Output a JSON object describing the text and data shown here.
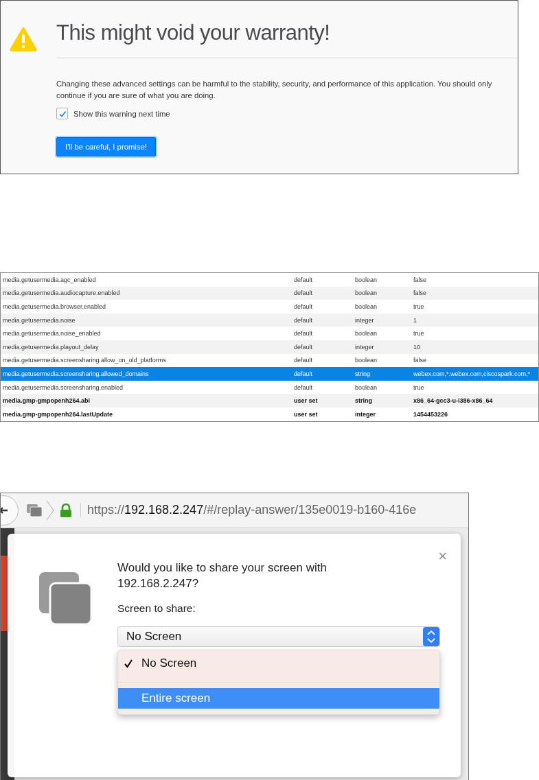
{
  "warning": {
    "title": "This might void your warranty!",
    "message": "Changing these advanced settings can be harmful to the stability, security, and performance of this application. You should only continue if you are sure of what you are doing.",
    "checkbox": {
      "label": "Show this warning next time",
      "checked": true
    },
    "button": "I'll be careful, I promise!"
  },
  "prefs": {
    "rows": [
      {
        "name": "media.getusermedia.agc_enabled",
        "status": "default",
        "type": "boolean",
        "value": "false",
        "modified": false,
        "selected": false
      },
      {
        "name": "media.getusermedia.audiocapture.enabled",
        "status": "default",
        "type": "boolean",
        "value": "false",
        "modified": false,
        "selected": false
      },
      {
        "name": "media.getusermedia.browser.enabled",
        "status": "default",
        "type": "boolean",
        "value": "true",
        "modified": false,
        "selected": false
      },
      {
        "name": "media.getusermedia.noise",
        "status": "default",
        "type": "integer",
        "value": "1",
        "modified": false,
        "selected": false
      },
      {
        "name": "media.getusermedia.noise_enabled",
        "status": "default",
        "type": "boolean",
        "value": "true",
        "modified": false,
        "selected": false
      },
      {
        "name": "media.getusermedia.playout_delay",
        "status": "default",
        "type": "integer",
        "value": "10",
        "modified": false,
        "selected": false
      },
      {
        "name": "media.getusermedia.screensharing.allow_on_old_platforms",
        "status": "default",
        "type": "boolean",
        "value": "false",
        "modified": false,
        "selected": false
      },
      {
        "name": "media.getusermedia.screensharing.allowed_domains",
        "status": "default",
        "type": "string",
        "value": "webex.com,*.webex.com,ciscospark.com,*",
        "modified": false,
        "selected": true
      },
      {
        "name": "media.getusermedia.screensharing.enabled",
        "status": "default",
        "type": "boolean",
        "value": "true",
        "modified": false,
        "selected": false
      },
      {
        "name": "media.gmp-gmpopenh264.abi",
        "status": "user set",
        "type": "string",
        "value": "x86_64-gcc3-u-i386-x86_64",
        "modified": true,
        "selected": false
      },
      {
        "name": "media.gmp-gmpopenh264.lastUpdate",
        "status": "user set",
        "type": "integer",
        "value": "1454453226",
        "modified": true,
        "selected": false
      }
    ]
  },
  "share_dialog": {
    "url": {
      "scheme": "https://",
      "host": "192.168.2.247",
      "path": "/#/replay-answer/135e0019-b160-416e"
    },
    "close": "×",
    "question": "Would you like to share your screen with 192.168.2.247?",
    "select_label": "Screen to share:",
    "select_value": "No Screen",
    "options": [
      {
        "label": "No Screen",
        "checked": true,
        "selected": false
      },
      {
        "label": "Entire screen",
        "checked": false,
        "selected": true
      }
    ]
  }
}
